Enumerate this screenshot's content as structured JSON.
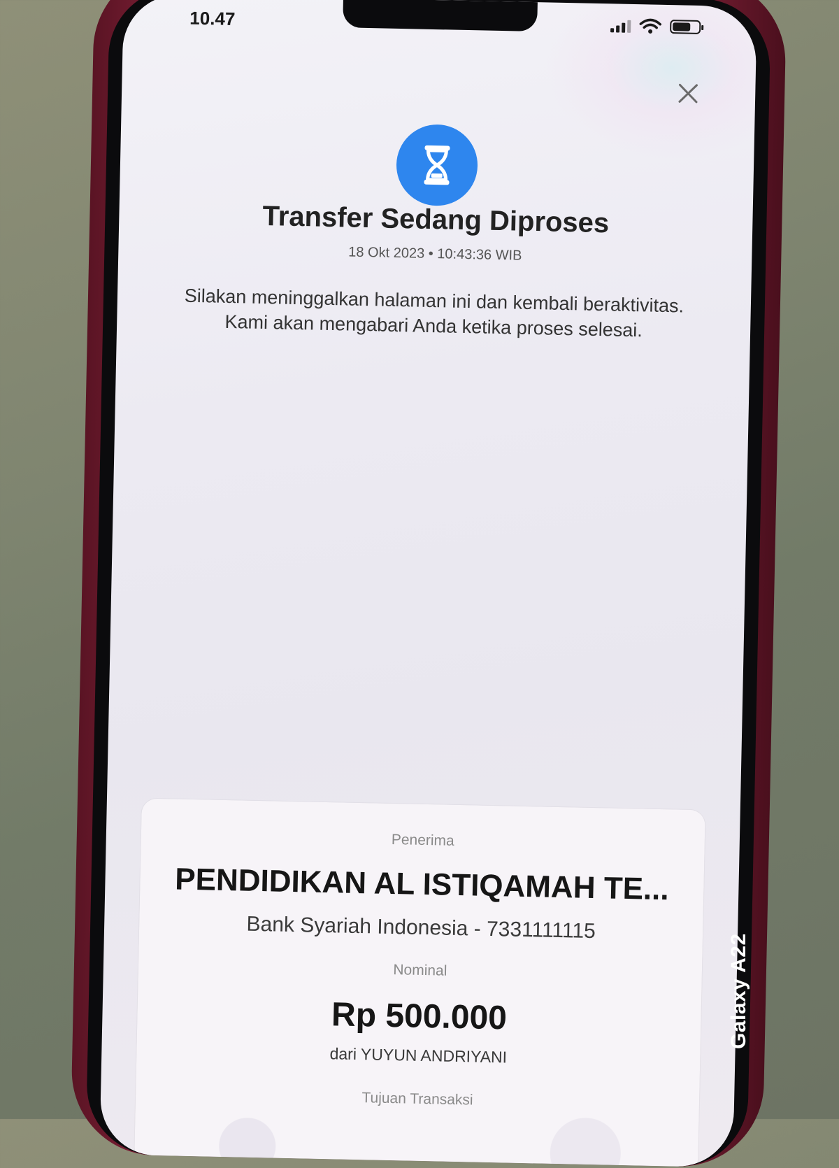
{
  "status_bar": {
    "time": "10.47",
    "battery_level": 0.7
  },
  "header": {
    "close_icon": "close-icon"
  },
  "status": {
    "icon": "hourglass-icon",
    "accent_color": "#2e86ee",
    "title": "Transfer Sedang Diproses",
    "datetime": "18 Okt 2023 • 10:43:36 WIB",
    "message": "Silakan meninggalkan halaman ini dan kembali beraktivitas. Kami akan mengabari Anda ketika proses selesai."
  },
  "details": {
    "recipient_label": "Penerima",
    "recipient_name": "PENDIDIKAN AL ISTIQAMAH TE...",
    "recipient_bank": "Bank Syariah Indonesia - 7331111115",
    "amount_label": "Nominal",
    "amount": "Rp 500.000",
    "sender": "dari YUYUN ANDRIYANI",
    "purpose_label": "Tujuan Transaksi"
  },
  "camera_watermark": "Galaxy A22"
}
